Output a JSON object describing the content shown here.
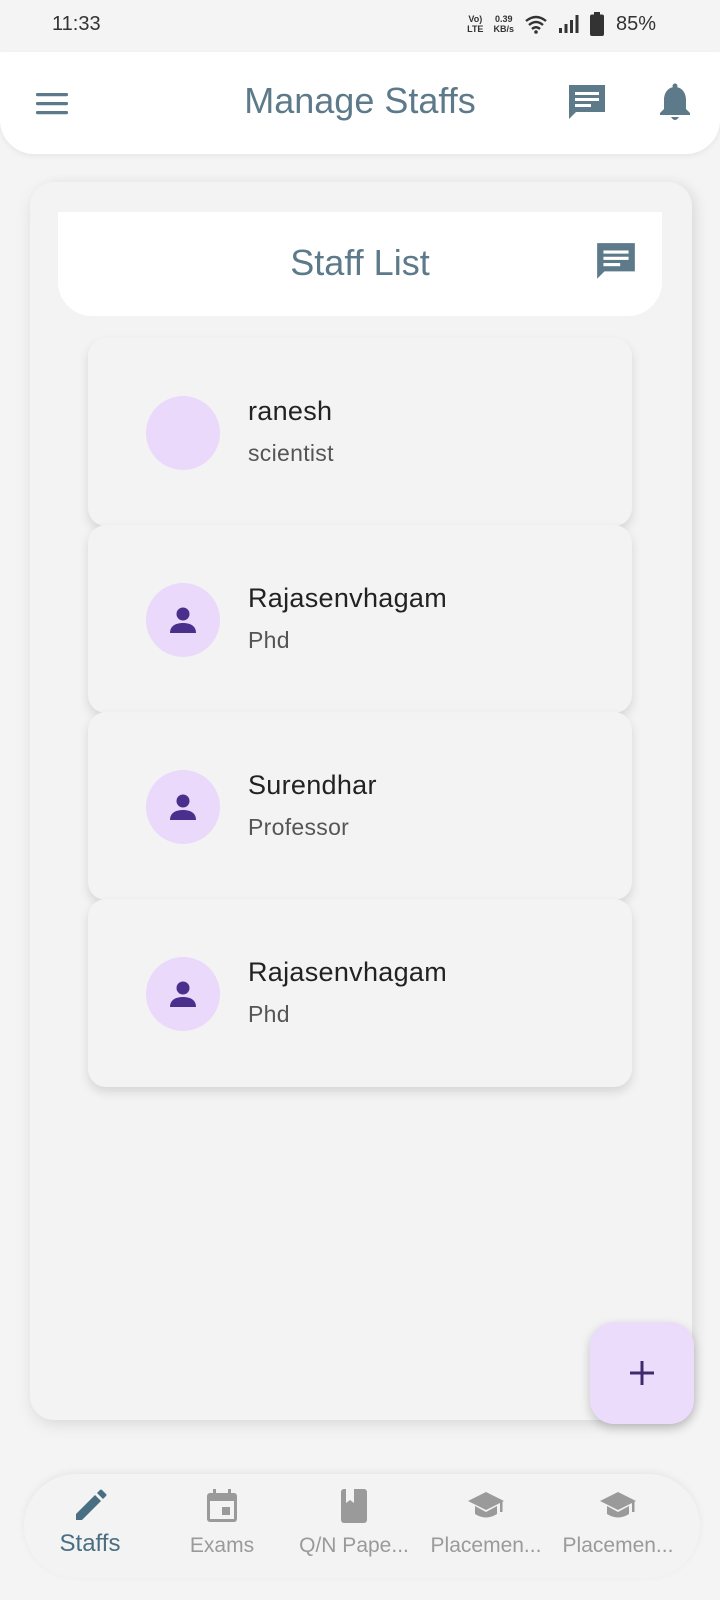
{
  "status_bar": {
    "time": "11:33",
    "volte_top": "Vo)",
    "volte_bottom": "LTE",
    "net_speed_top": "0.39",
    "net_speed_bottom": "KB/s",
    "battery": "85%",
    "icons": [
      "wifi-icon",
      "signal-icon",
      "battery-icon"
    ]
  },
  "app_bar": {
    "title": "Manage Staffs",
    "icons": [
      "menu-icon",
      "chat-icon",
      "bell-icon"
    ]
  },
  "staff_list": {
    "title": "Staff List",
    "items": [
      {
        "name": "ranesh",
        "role": "scientist",
        "avatar": "empty"
      },
      {
        "name": "Rajasenvhagam",
        "role": "Phd",
        "avatar": "person-icon"
      },
      {
        "name": "Surendhar",
        "role": "Professor",
        "avatar": "person-icon"
      },
      {
        "name": "Rajasenvhagam",
        "role": "Phd",
        "avatar": "person-icon"
      }
    ]
  },
  "fab": {
    "icon": "plus-icon"
  },
  "bottom_nav": {
    "items": [
      {
        "label": "Staffs",
        "icon": "pencil-icon",
        "active": true
      },
      {
        "label": "Exams",
        "icon": "calendar-icon",
        "active": false
      },
      {
        "label": "Q/N Pape...",
        "icon": "book-icon",
        "active": false
      },
      {
        "label": "Placemen...",
        "icon": "graduation-cap-icon",
        "active": false
      },
      {
        "label": "Placemen...",
        "icon": "graduation-cap-icon",
        "active": false
      }
    ]
  },
  "colors": {
    "accent": "#5d7a8a",
    "avatar_bg": "#ead9fb",
    "avatar_icon": "#4b2f8c",
    "fab_bg": "#ecdcfc",
    "background": "#f4f4f4"
  }
}
